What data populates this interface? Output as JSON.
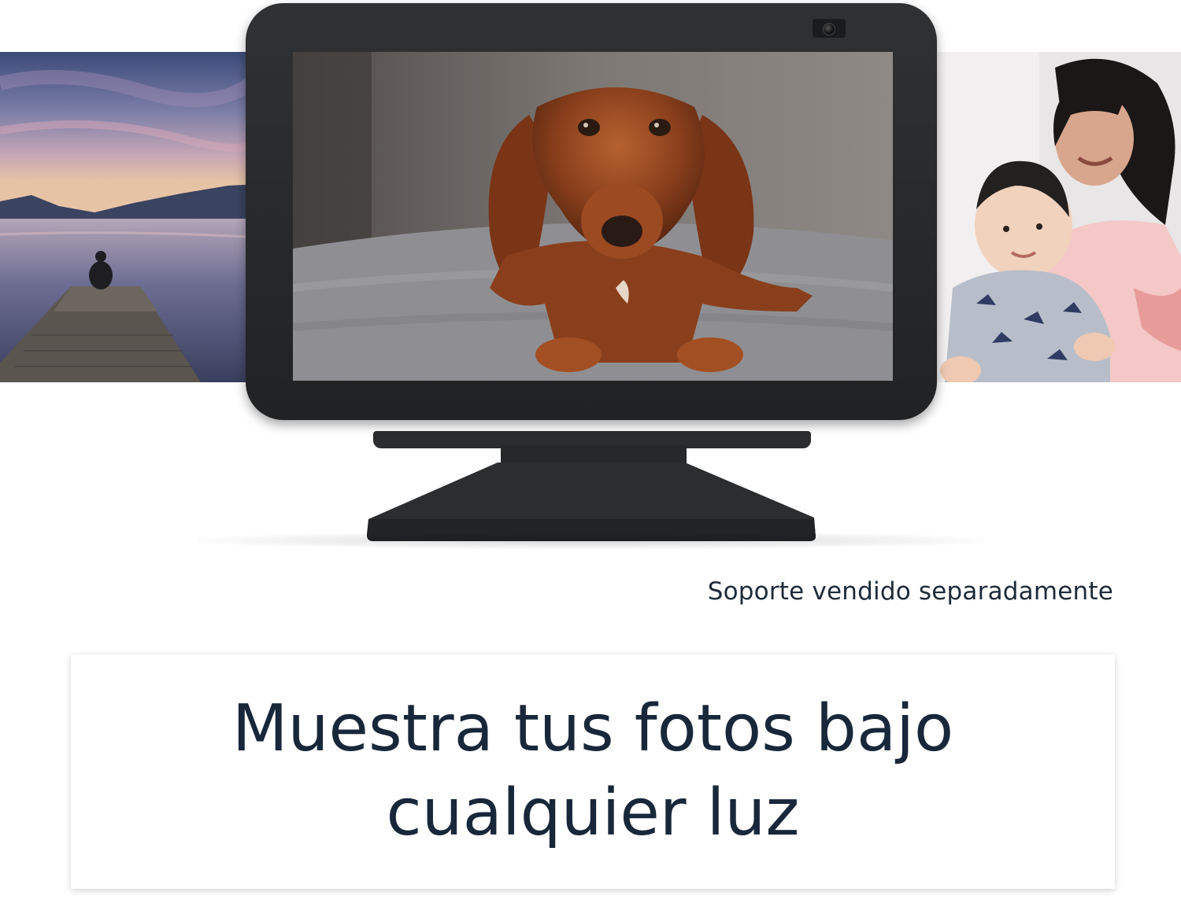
{
  "caption": "Soporte vendido separadamente",
  "headline": "Muestra tus fotos bajo cualquier luz",
  "images": {
    "left_photo": "lake-pier-sunset-image",
    "screen_photo": "dachshund-dog-image",
    "right_photo": "mother-and-baby-image"
  },
  "colors": {
    "device": "#26282a",
    "text": "#18273a",
    "background": "#ffffff"
  }
}
